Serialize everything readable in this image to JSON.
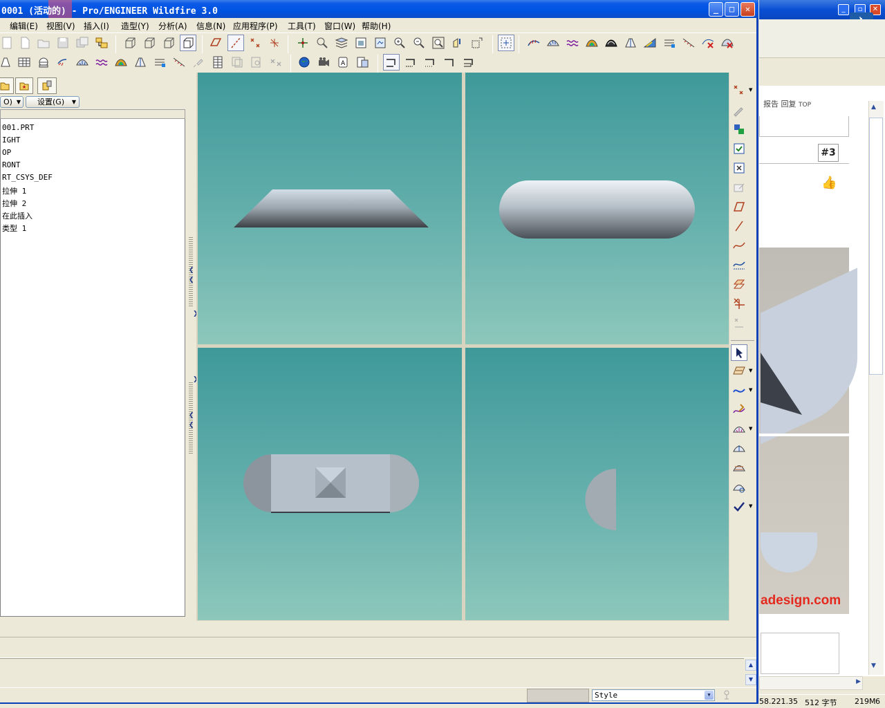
{
  "window": {
    "title": "0001 (活动的) - Pro/ENGINEER Wildfire 3.0",
    "minimize": "_",
    "maximize": "□",
    "close": "✕"
  },
  "menubar": {
    "items": [
      {
        "label": "编辑(E)"
      },
      {
        "label": "视图(V)"
      },
      {
        "label": "插入(I)"
      },
      {
        "label": "造型(Y)"
      },
      {
        "label": "分析(A)"
      },
      {
        "label": "信息(N)"
      },
      {
        "label": "应用程序(P)"
      },
      {
        "label": "工具(T)"
      },
      {
        "label": "窗口(W)"
      },
      {
        "label": "帮助(H)"
      }
    ]
  },
  "navigator": {
    "show_dropdown": "O)",
    "settings_dropdown": "设置(G)",
    "tree": [
      {
        "label": "001.PRT"
      },
      {
        "label": "IGHT"
      },
      {
        "label": "OP"
      },
      {
        "label": "RONT"
      },
      {
        "label": "RT_CSYS_DEF"
      },
      {
        "label": "拉伸 1"
      },
      {
        "label": "拉伸 2"
      },
      {
        "label": "在此插入"
      },
      {
        "label": "类型 1"
      }
    ]
  },
  "statusbar": {
    "style_value": "Style"
  },
  "background_app": {
    "reply_text": "报告 回复",
    "top_text": "TOP",
    "post_badge": "#3",
    "watermark": "adesign.com",
    "status_ip": "58.221.35",
    "status_bytes": "512 字节",
    "status_mem": "219M",
    "status_num": "6"
  },
  "colors": {
    "viewport_top": "#3f9999",
    "viewport_bottom": "#8dc7bb",
    "titlebar": "#0053e1",
    "chrome": "#ece9d8"
  }
}
